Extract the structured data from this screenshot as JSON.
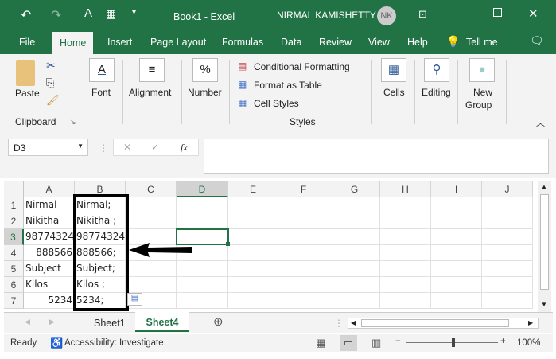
{
  "title_bar": {
    "doc_title": "Book1  -  Excel",
    "user_name": "NIRMAL KAMISHETTY",
    "avatar_initials": "NK"
  },
  "menu_tabs": [
    "File",
    "Home",
    "Insert",
    "Page Layout",
    "Formulas",
    "Data",
    "Review",
    "View",
    "Help",
    "Tell me"
  ],
  "ribbon": {
    "paste": "Paste",
    "clipboard": "Clipboard",
    "font": "Font",
    "alignment": "Alignment",
    "number": "Number",
    "conditional_formatting": "Conditional Formatting",
    "format_as_table": "Format as Table",
    "cell_styles": "Cell Styles",
    "styles": "Styles",
    "cells": "Cells",
    "editing": "Editing",
    "new": "New",
    "group": "Group"
  },
  "formula_bar": {
    "name_box": "D3",
    "fx": "fx",
    "value": ""
  },
  "columns": [
    "A",
    "B",
    "C",
    "D",
    "E",
    "F",
    "G",
    "H",
    "I",
    "J"
  ],
  "rows": [
    "1",
    "2",
    "3",
    "4",
    "5",
    "6",
    "7"
  ],
  "col_a": [
    "Nirmal",
    "Nikitha",
    "98774324",
    "888566",
    "Subject",
    "Kilos",
    "5234"
  ],
  "col_b": [
    "Nirmal;",
    "Nikitha ;",
    "98774324;",
    "888566;",
    "Subject;",
    "Kilos ;",
    "5234;"
  ],
  "selected_cell": "D3",
  "sheets": [
    "Sheet1",
    "Sheet4"
  ],
  "active_sheet": "Sheet4",
  "status": {
    "ready": "Ready",
    "accessibility": "Accessibility: Investigate",
    "zoom": "100%"
  },
  "colors": {
    "accent": "#217346"
  }
}
